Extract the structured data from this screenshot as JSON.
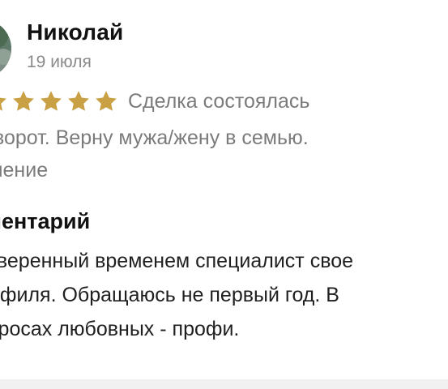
{
  "review": {
    "author": "Николай",
    "date": "19 июля",
    "rating": 5,
    "rating_max": 5,
    "deal_status": "Сделка состоялась",
    "service_title": "иворот. Верну мужа/жену в семью.",
    "service_subtitle": "учение",
    "comment_heading": "мментарий",
    "comment_lines": [
      "оверенный временем специалист свое",
      "офиля. Обращаюсь не первый год. В",
      "просах любовных - профи."
    ]
  },
  "colors": {
    "star": "#c9a043",
    "muted_text": "#7b7b7b",
    "date_text": "#8a8a8a",
    "divider": "#f1f1f1"
  },
  "icons": {
    "avatar": "user-photo",
    "star": "star-icon"
  }
}
